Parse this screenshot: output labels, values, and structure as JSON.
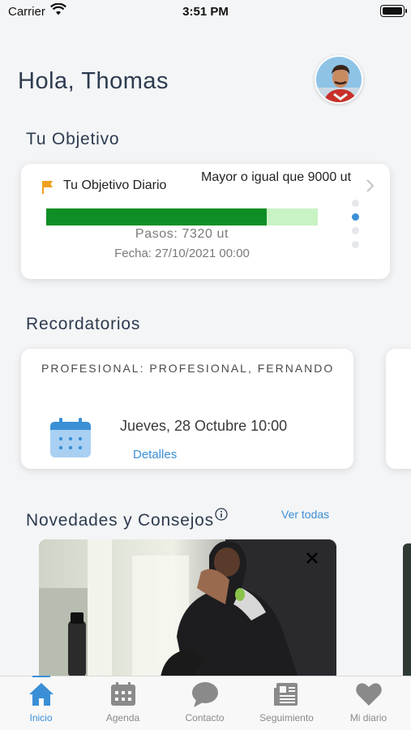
{
  "status_bar": {
    "carrier": "Carrier",
    "time": "3:51 PM"
  },
  "header": {
    "greeting": "Hola, Thomas"
  },
  "goal": {
    "section_title": "Tu Objetivo",
    "label": "Tu Objetivo Diario",
    "target": "Mayor o igual que 9000 ut",
    "steps": "Pasos: 7320 ut",
    "date": "Fecha: 27/10/2021 00:00",
    "progress_fraction": 0.813
  },
  "reminders": {
    "section_title": "Recordatorios",
    "items": [
      {
        "professional": "PROFESIONAL: PROFESIONAL, FERNANDO",
        "when": "Jueves, 28 Octubre 10:00",
        "details_label": "Detalles"
      }
    ]
  },
  "news": {
    "section_title": "Novedades y Consejos",
    "see_all": "Ver todas"
  },
  "tab_bar": {
    "tabs": [
      {
        "label": "Inicio",
        "icon": "home-icon",
        "active": true
      },
      {
        "label": "Agenda",
        "icon": "calendar-icon",
        "active": false
      },
      {
        "label": "Contacto",
        "icon": "chat-bubble-icon",
        "active": false
      },
      {
        "label": "Seguimiento",
        "icon": "newspaper-icon",
        "active": false
      },
      {
        "label": "Mi diario",
        "icon": "heart-icon",
        "active": false
      }
    ]
  },
  "colors": {
    "accent": "#3b8fd6",
    "progress": "#0e8e25",
    "progress_track": "#c8f3c4",
    "flag": "#f0a020"
  }
}
